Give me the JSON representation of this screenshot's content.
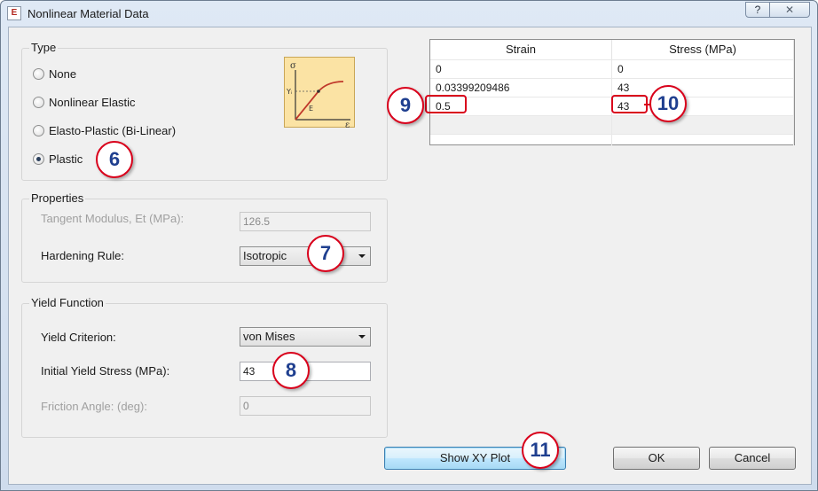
{
  "window": {
    "title": "Nonlinear Material Data",
    "help_label": "?",
    "close_label": "✕",
    "app_icon_letter": "E"
  },
  "type_group": {
    "label": "Type",
    "options": [
      {
        "label": "None",
        "checked": false
      },
      {
        "label": "Nonlinear Elastic",
        "checked": false
      },
      {
        "label": "Elasto-Plastic (Bi-Linear)",
        "checked": false
      },
      {
        "label": "Plastic",
        "checked": true
      }
    ],
    "graph": {
      "sigma": "σ",
      "epsilon": "ε",
      "yield": "Yᵢ",
      "modulus": "E"
    }
  },
  "properties_group": {
    "label": "Properties",
    "tangent_label": "Tangent Modulus, Et (MPa):",
    "tangent_value": "126.5",
    "hardening_label": "Hardening Rule:",
    "hardening_value": "Isotropic"
  },
  "yield_group": {
    "label": "Yield Function",
    "criterion_label": "Yield Criterion:",
    "criterion_value": "von Mises",
    "initial_label": "Initial Yield Stress (MPa):",
    "initial_value": "43",
    "friction_label": "Friction Angle: (deg):",
    "friction_value": "0"
  },
  "table": {
    "headers": [
      "Strain",
      "Stress (MPa)"
    ],
    "rows": [
      [
        "0",
        "0"
      ],
      [
        "0.03399209486",
        "43"
      ],
      [
        "0.5",
        "43"
      ]
    ]
  },
  "buttons": {
    "show_xy_plot": "Show XY Plot",
    "ok": "OK",
    "cancel": "Cancel"
  },
  "callouts": [
    "6",
    "7",
    "8",
    "9",
    "10",
    "11"
  ],
  "colors": {
    "callout_border": "#d9001b",
    "callout_text": "#1f3f8f",
    "graph_bg": "#fbe3a4"
  }
}
